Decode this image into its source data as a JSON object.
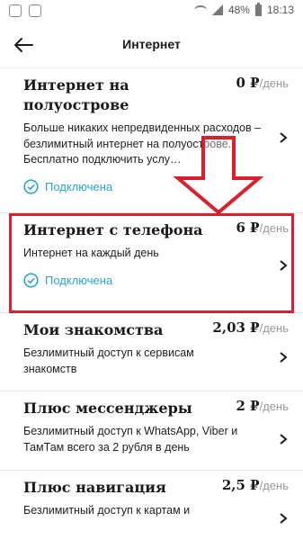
{
  "status_bar": {
    "battery": "48%",
    "time": "18:13"
  },
  "header": {
    "title": "Интернет",
    "back_icon": "arrow-left-icon"
  },
  "items": [
    {
      "name": "Интернет на полуострове",
      "price": "0 ₽",
      "price_unit": "/день",
      "description": "Больше никаких непредвиденных расходов – безлимитный интернет на полуострове. Бесплатно подключить услу…",
      "status": "Подключена"
    },
    {
      "name": "Интернет с телефона",
      "price": "6 ₽",
      "price_unit": "/день",
      "description": "Интернет на каждый день",
      "status": "Подключена"
    },
    {
      "name": "Мои знакомства",
      "price": "2,03 ₽",
      "price_unit": "/день",
      "description": "Безлимитный доступ к сервисам знакомств"
    },
    {
      "name": "Плюс мессенджеры",
      "price": "2 ₽",
      "price_unit": "/день",
      "description": "Безлимитный доступ к WhatsApp, Viber и ТамТам всего за 2 рубля в день"
    },
    {
      "name": "Плюс навигация",
      "price": "2,5 ₽",
      "price_unit": "/день",
      "description": "Безлимитный доступ к картам и"
    }
  ],
  "annotation": {
    "highlight_color": "#d9202c",
    "accent_color": "#26a8c7"
  }
}
